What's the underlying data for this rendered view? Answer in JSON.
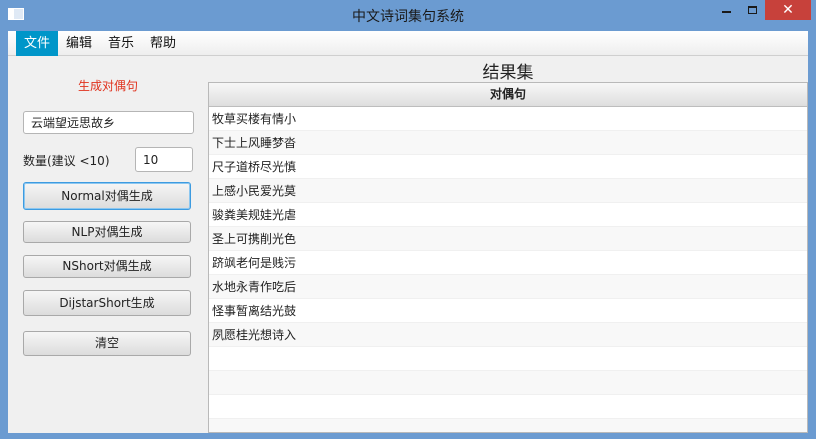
{
  "window": {
    "title": "中文诗词集句系统",
    "close_glyph": "✕",
    "icons": {
      "app": "app-window-icon",
      "minimize": "minimize-icon",
      "maximize": "maximize-icon",
      "close": "close-icon"
    }
  },
  "menu": {
    "items": [
      {
        "label": "文件",
        "active": true
      },
      {
        "label": "编辑",
        "active": false
      },
      {
        "label": "音乐",
        "active": false
      },
      {
        "label": "帮助",
        "active": false
      }
    ]
  },
  "left_panel": {
    "heading": "生成对偶句",
    "poem_input_value": "云端望远思故乡",
    "count_label": "数量(建议 <10)",
    "count_value": "10",
    "buttons": {
      "normal": "Normal对偶生成",
      "nlp": "NLP对偶生成",
      "nshort": "NShort对偶生成",
      "dijstar": "DijstarShort生成",
      "clear": "清空"
    }
  },
  "right_panel": {
    "title": "结果集",
    "column_header": "对偶句",
    "rows": [
      "牧草买楼有情小",
      "下士上风睡梦沓",
      "尺子道桥尽光慎",
      "上感小民爱光莫",
      "骏粪美规娃光虐",
      "圣上可携削光色",
      "跻飒老何是贱污",
      "水地永青作吃后",
      "怪事暂离结光鼓",
      "夙愿桂光想诗入"
    ],
    "empty_rows": 4
  },
  "colors": {
    "titlebar": "#6b9bd1",
    "menu_active": "#0096c9",
    "heading_red": "#e0321e",
    "close_button": "#c7413b"
  }
}
